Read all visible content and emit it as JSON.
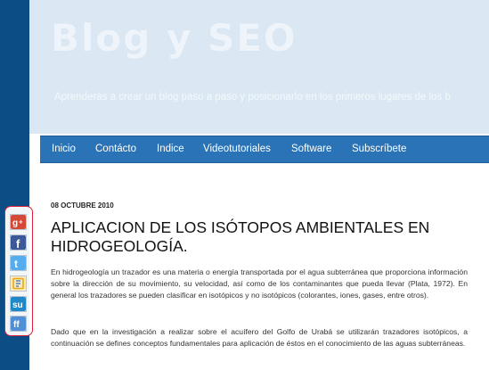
{
  "blog": {
    "title": "Blog y SEO",
    "tagline": "Aprenderás a crear un blog paso a paso y posicionarlo en los primeros lugares de los b"
  },
  "nav": {
    "items": [
      {
        "id": "inicio",
        "label": "Inicio"
      },
      {
        "id": "contacto",
        "label": "Contácto"
      },
      {
        "id": "indice",
        "label": "Indice"
      },
      {
        "id": "videotutoriales",
        "label": "Videotutoriales"
      },
      {
        "id": "software",
        "label": "Software"
      },
      {
        "id": "suscribete",
        "label": "Subscríbete"
      }
    ]
  },
  "post": {
    "date": "08 OCTUBRE 2010",
    "title": "APLICACION DE LOS ISÓTOPOS AMBIENTALES EN HIDROGEOLOGÍA.",
    "paragraphs": [
      "En hidrogeología un trazador es una materia o energía transportada por el agua subterránea que proporciona información sobre la dirección de su movimiento, su velocidad, así como de los contaminantes que pueda llevar (Plata, 1972). En general los trazadores se pueden clasificar en isotópicos y no isotópicos (colorantes, iones, gases, entre otros).",
      "Dado que en la investigación a realizar sobre el acuífero del Golfo de Urabá se utilizarán trazadores isotópicos, a continuación se defines conceptos fundamentales para aplicación de éstos en el conocimiento de las aguas subterráneas."
    ]
  },
  "share": {
    "buttons": [
      {
        "icon": "google-plus-icon",
        "color": "#d34836"
      },
      {
        "icon": "facebook-icon",
        "color": "#3b5998"
      },
      {
        "icon": "twitter-icon",
        "color": "#55acee"
      },
      {
        "icon": "bookmark-icon",
        "color": "#e6a81e"
      },
      {
        "icon": "stumbleupon-icon",
        "color": "#1e88c8"
      },
      {
        "icon": "friendfeed-icon",
        "color": "#4f8fd6"
      }
    ]
  },
  "colors": {
    "nav_background": "#2a73b6",
    "header_background": "#dbe8f4",
    "left_band": "#0c4d86",
    "highlight_border": "#e0203a"
  }
}
